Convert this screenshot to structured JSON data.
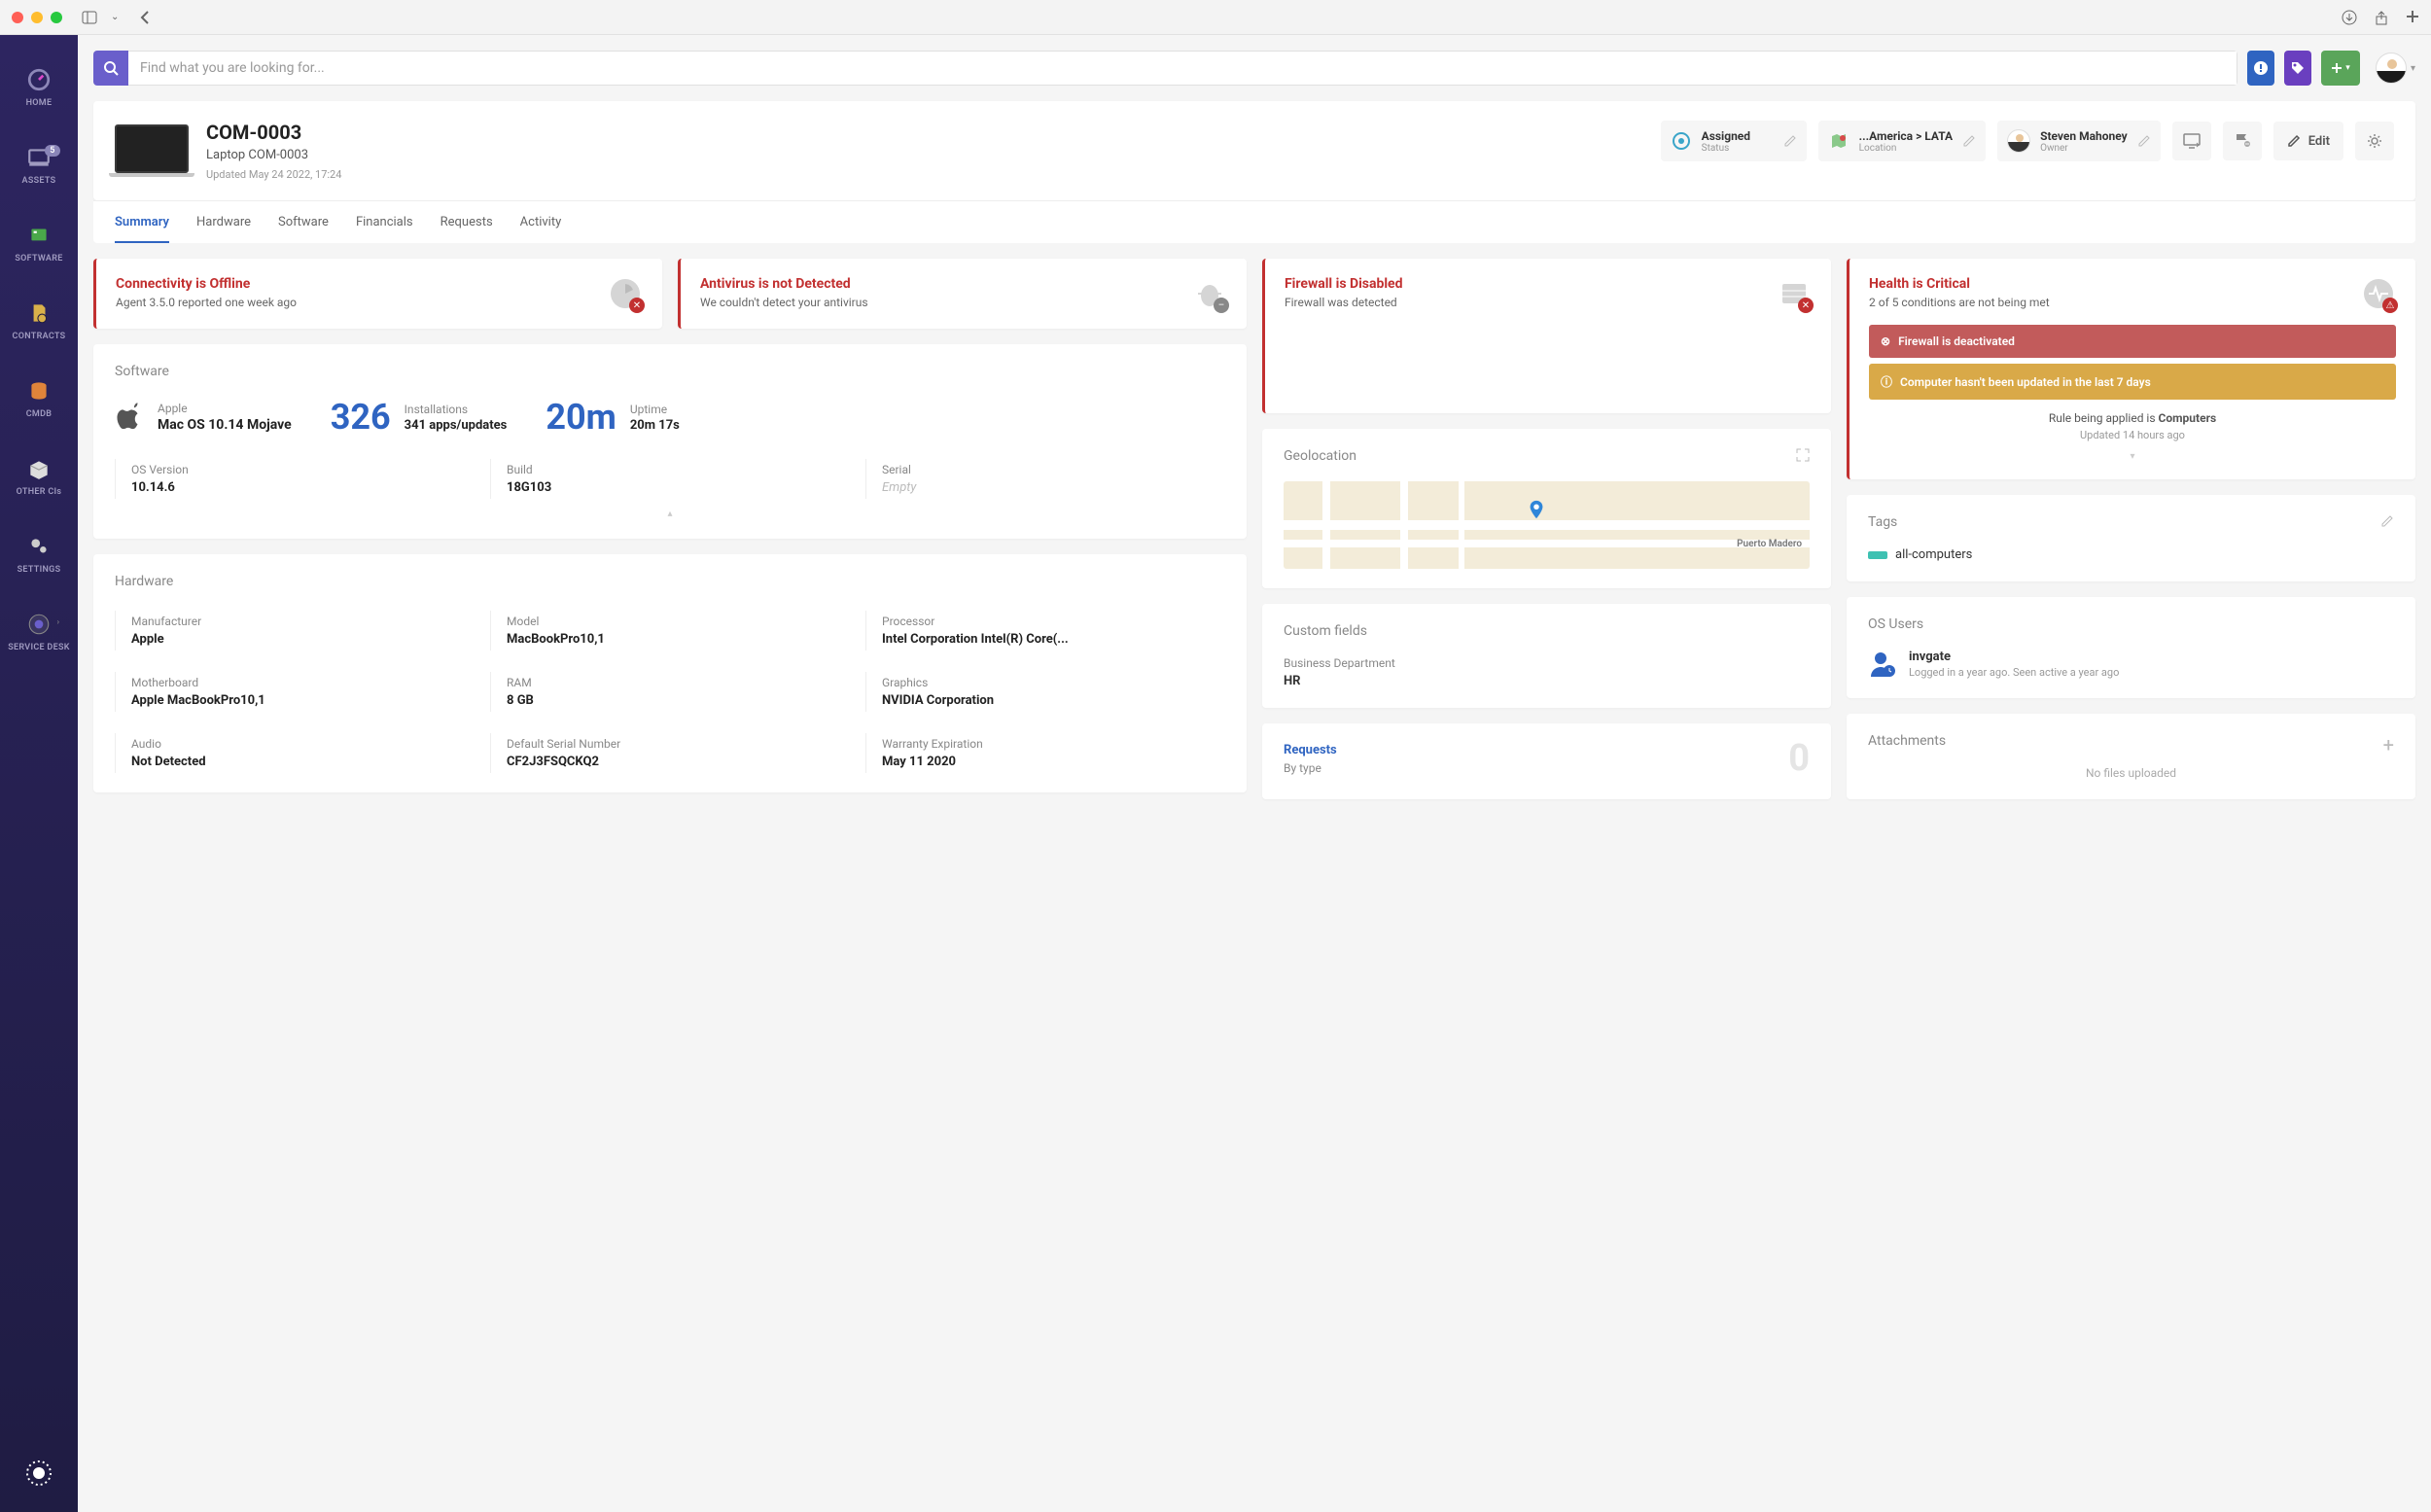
{
  "titlebar": {
    "has_back": true
  },
  "sidenav": {
    "items": [
      {
        "label": "HOME"
      },
      {
        "label": "ASSETS",
        "badge": "5"
      },
      {
        "label": "SOFTWARE"
      },
      {
        "label": "CONTRACTS"
      },
      {
        "label": "CMDB"
      },
      {
        "label": "OTHER CIs"
      },
      {
        "label": "SETTINGS"
      },
      {
        "label": "SERVICE DESK"
      }
    ]
  },
  "search": {
    "placeholder": "Find what you are looking for..."
  },
  "asset": {
    "id": "COM-0003",
    "name": "Laptop COM-0003",
    "updated": "Updated May 24 2022, 17:24"
  },
  "pills": {
    "status": {
      "title": "Assigned",
      "sub": "Status"
    },
    "location": {
      "title": "...America > LATA",
      "sub": "Location"
    },
    "owner": {
      "title": "Steven Mahoney",
      "sub": "Owner"
    },
    "edit_label": "Edit"
  },
  "tabs": [
    "Summary",
    "Hardware",
    "Software",
    "Financials",
    "Requests",
    "Activity"
  ],
  "alerts": {
    "connectivity": {
      "title": "Connectivity is Offline",
      "sub": "Agent 3.5.0 reported one week ago"
    },
    "antivirus": {
      "title": "Antivirus is not Detected",
      "sub": "We couldn't detect your antivirus"
    },
    "firewall": {
      "title": "Firewall is Disabled",
      "sub": "Firewall was detected"
    },
    "health": {
      "title": "Health is Critical",
      "sub": "2 of 5 conditions are not being met"
    }
  },
  "health_banners": {
    "b1": "Firewall is deactivated",
    "b2": "Computer hasn't been updated in the last 7 days",
    "rule_text": "Rule being applied is ",
    "rule_link": "Computers",
    "rule_upd": "Updated 14 hours ago"
  },
  "software": {
    "title": "Software",
    "os_label": "Apple",
    "os_name": "Mac OS 10.14 Mojave",
    "installs_num": "326",
    "installs_label": "Installations",
    "installs_sub": "341 apps/updates",
    "uptime_num": "20m",
    "uptime_label": "Uptime",
    "uptime_sub": "20m 17s",
    "fields": [
      {
        "k": "OS Version",
        "v": "10.14.6"
      },
      {
        "k": "Build",
        "v": "18G103"
      },
      {
        "k": "Serial",
        "v": "Empty",
        "empty": true
      }
    ]
  },
  "hardware": {
    "title": "Hardware",
    "fields": [
      {
        "k": "Manufacturer",
        "v": "Apple"
      },
      {
        "k": "Model",
        "v": "MacBookPro10,1"
      },
      {
        "k": "Processor",
        "v": "Intel Corporation Intel(R) Core(..."
      },
      {
        "k": "Motherboard",
        "v": "Apple MacBookPro10,1"
      },
      {
        "k": "RAM",
        "v": "8 GB"
      },
      {
        "k": "Graphics",
        "v": "NVIDIA Corporation"
      },
      {
        "k": "Audio",
        "v": "Not Detected"
      },
      {
        "k": "Default Serial Number",
        "v": "CF2J3FSQCKQ2"
      },
      {
        "k": "Warranty Expiration",
        "v": "May 11 2020"
      }
    ]
  },
  "geo": {
    "title": "Geolocation",
    "place": "Puerto Madero"
  },
  "custom_fields": {
    "title": "Custom fields",
    "k": "Business Department",
    "v": "HR"
  },
  "requests": {
    "title": "Requests",
    "sub": "By type",
    "count": "0"
  },
  "tags": {
    "title": "Tags",
    "tag": "all-computers"
  },
  "os_users": {
    "title": "OS Users",
    "name": "invgate",
    "meta": "Logged in a year ago. Seen active a year ago"
  },
  "attachments": {
    "title": "Attachments",
    "empty": "No files uploaded"
  }
}
